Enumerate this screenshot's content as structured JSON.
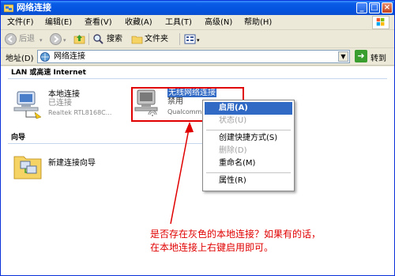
{
  "window": {
    "title": "网络连接",
    "controls": [
      "_",
      "□",
      "×"
    ]
  },
  "menubar": [
    {
      "label": "文件(F)"
    },
    {
      "label": "编辑(E)"
    },
    {
      "label": "查看(V)"
    },
    {
      "label": "收藏(A)"
    },
    {
      "label": "工具(T)"
    },
    {
      "label": "高级(N)"
    },
    {
      "label": "帮助(H)"
    }
  ],
  "toolbar": {
    "back": "后退",
    "search": "搜索",
    "folders": "文件夹"
  },
  "address": {
    "label": "地址(D)",
    "value": "网络连接",
    "go": "转到"
  },
  "groups": {
    "lan_title": "LAN 或高速 Internet",
    "wizard_title": "向导"
  },
  "connections": {
    "local": {
      "name": "本地连接",
      "status": "已连接",
      "device": "Realtek RTL8168C..."
    },
    "wireless": {
      "name": "无线网络连接",
      "status": "禁用",
      "device": "Qualcomm"
    }
  },
  "wizard": {
    "label": "新建连接向导"
  },
  "context_menu": {
    "items": [
      {
        "label": "启用(A)",
        "state": "selected"
      },
      {
        "label": "状态(U)",
        "state": "disabled"
      },
      {
        "label": "创建快捷方式(S)",
        "state": "normal"
      },
      {
        "label": "删除(D)",
        "state": "disabled"
      },
      {
        "label": "重命名(M)",
        "state": "normal"
      },
      {
        "label": "属性(R)",
        "state": "normal"
      }
    ]
  },
  "annotation": {
    "line1": "是否存在灰色的本地连接？如果有的话，",
    "line2": "在本地连接上右键启用即可。",
    "color": "#e00000"
  },
  "colors": {
    "titlebar": "#0a5ce6",
    "menu_highlight": "#316ac5",
    "annotation": "#e00000"
  }
}
